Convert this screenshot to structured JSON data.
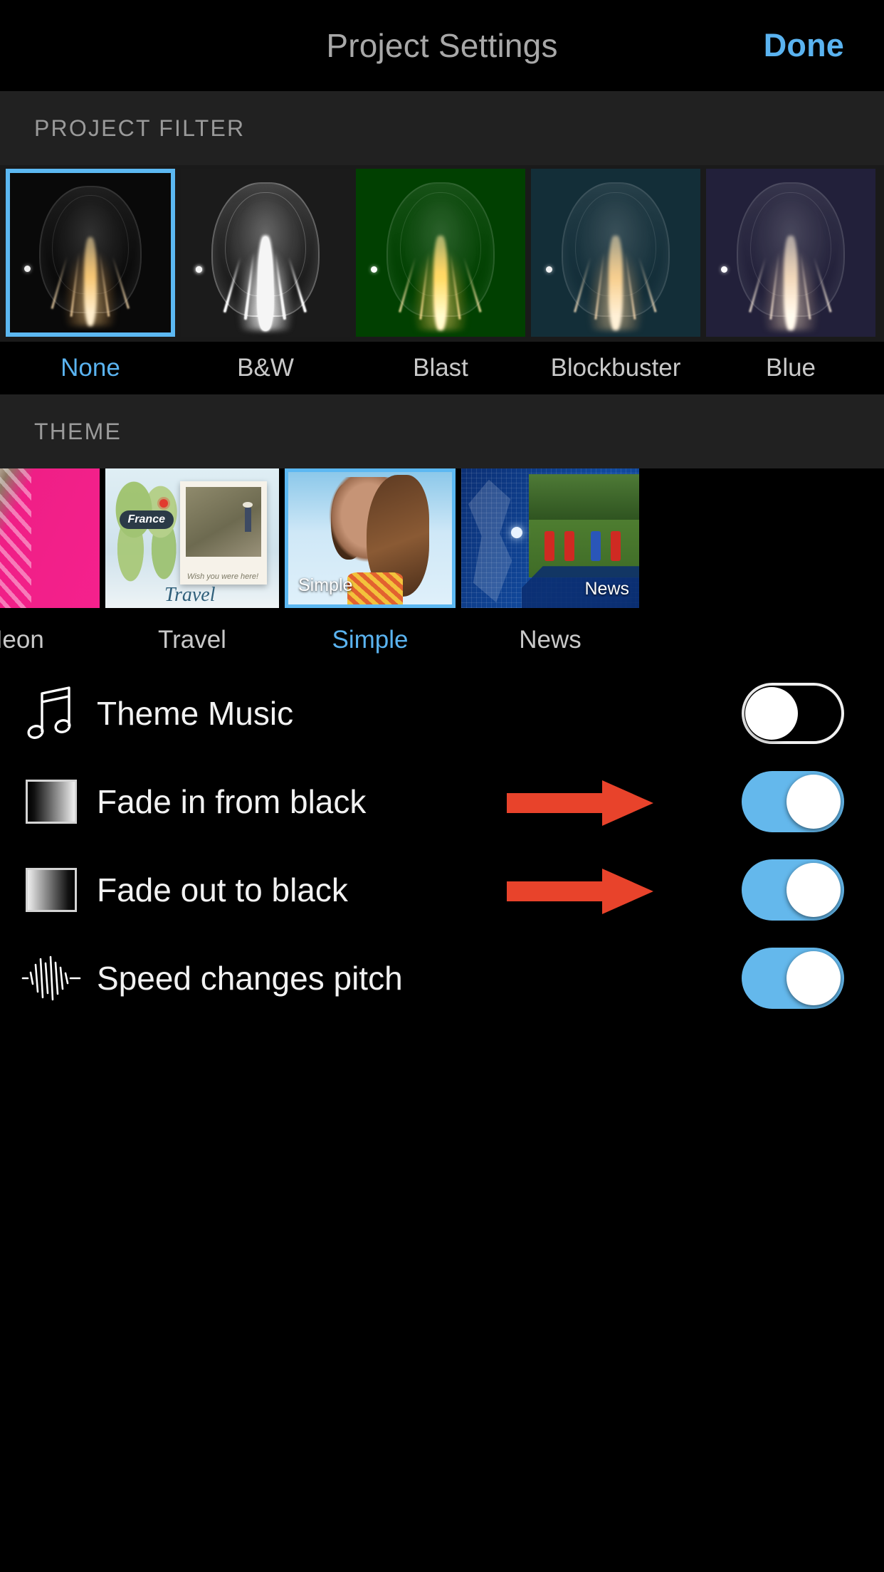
{
  "navbar": {
    "title": "Project Settings",
    "done_label": "Done",
    "done_color": "#5ab3f0"
  },
  "filter_section": {
    "header": "PROJECT FILTER",
    "selected": "None",
    "items": [
      {
        "label": "None",
        "icon": "filter-thumb-none",
        "selected": true
      },
      {
        "label": "B&W",
        "icon": "filter-thumb-bw",
        "selected": false
      },
      {
        "label": "Blast",
        "icon": "filter-thumb-blast",
        "selected": false
      },
      {
        "label": "Blockbuster",
        "icon": "filter-thumb-blockbuster",
        "selected": false
      },
      {
        "label": "Blue",
        "icon": "filter-thumb-blue",
        "selected": false
      }
    ]
  },
  "theme_section": {
    "header": "THEME",
    "selected": "Simple",
    "items": [
      {
        "label": "Neon",
        "overlay_text": "",
        "selected": false
      },
      {
        "label": "Travel",
        "overlay_text": "Travel",
        "selected": false
      },
      {
        "label": "Simple",
        "overlay_text": "Simple",
        "selected": true
      },
      {
        "label": "News",
        "overlay_text": "News",
        "selected": false
      }
    ]
  },
  "settings": {
    "rows": [
      {
        "label": "Theme Music",
        "icon": "music-note-icon",
        "toggle": "off",
        "arrow": false
      },
      {
        "label": "Fade in from black",
        "icon": "fade-in-icon",
        "toggle": "on",
        "arrow": true
      },
      {
        "label": "Fade out to black",
        "icon": "fade-out-icon",
        "toggle": "on",
        "arrow": true
      },
      {
        "label": "Speed changes pitch",
        "icon": "audio-waveform-icon",
        "toggle": "on",
        "arrow": false
      }
    ]
  },
  "annotations": {
    "arrow_color": "#e8432b",
    "arrow_direction": "right",
    "arrow_count": 2
  },
  "colors": {
    "background": "#000000",
    "section_header_bg": "#212121",
    "accent_blue": "#5ab3f0",
    "toggle_on": "#64b8ec",
    "label_gray": "#c9c9c9"
  }
}
